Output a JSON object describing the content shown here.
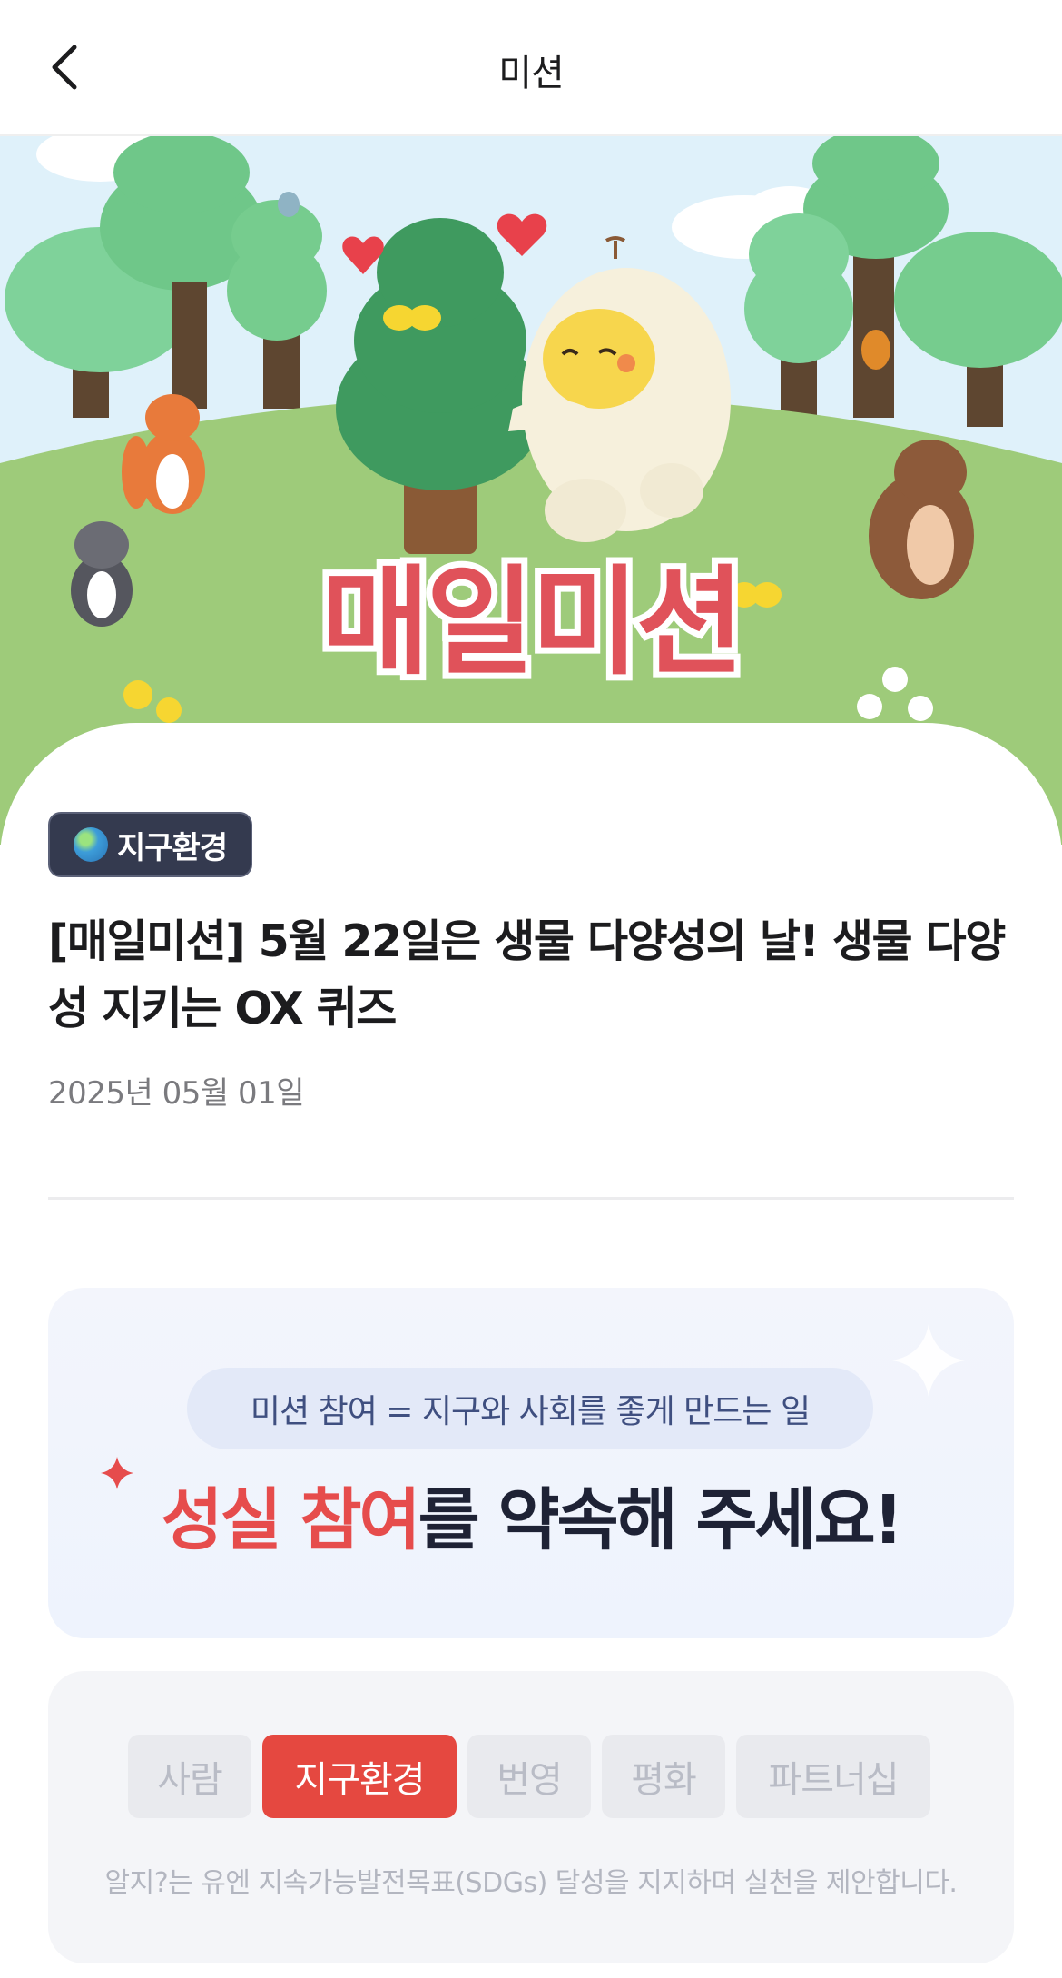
{
  "header": {
    "back_icon": "chevron-left-icon",
    "title": "미션"
  },
  "hero": {
    "banner_text": "매일미션",
    "banner_color": "#e0525a"
  },
  "post": {
    "category_chip": "지구환경",
    "category_icon": "globe-icon",
    "title": "[매일미션] 5월 22일은 생물 다양성의 날! 생물 다양성 지키는 OX 퀴즈",
    "date": "2025년 05월 01일"
  },
  "pledge": {
    "pill_text": "미션 참여 = 지구와 사회를 좋게 만드는 일",
    "highlight": "성실 참여",
    "rest": "를 약속해 주세요!",
    "highlight_color": "#e64c4c"
  },
  "categories": {
    "tabs": [
      {
        "label": "사람",
        "active": false
      },
      {
        "label": "지구환경",
        "active": true
      },
      {
        "label": "번영",
        "active": false
      },
      {
        "label": "평화",
        "active": false
      },
      {
        "label": "파트너십",
        "active": false
      }
    ],
    "note": "알지?는 유엔 지속가능발전목표(SDGs) 달성을 지지하며 실천을 제안합니다.",
    "active_color": "#e54840"
  }
}
